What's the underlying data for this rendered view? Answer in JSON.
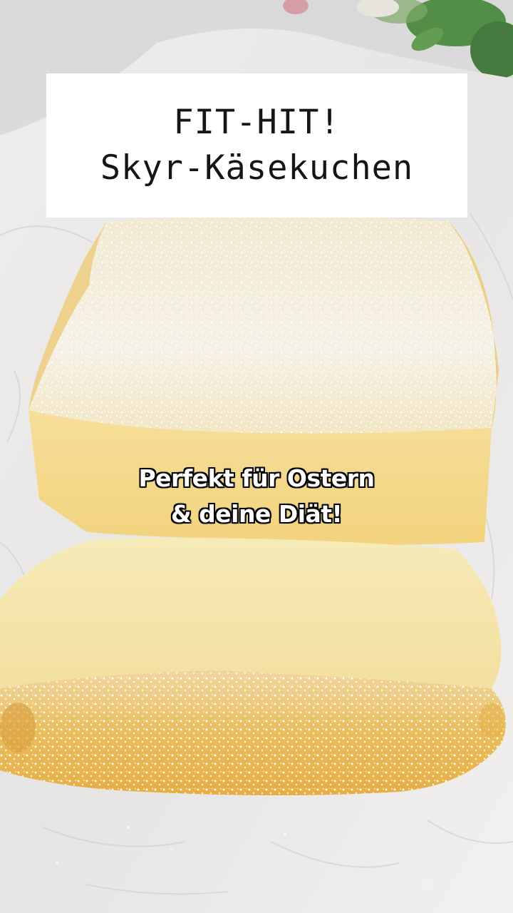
{
  "title_card": {
    "line1": "FIT-HIT!",
    "line2": "Skyr-Käsekuchen"
  },
  "caption": {
    "line1": "Perfekt für Ostern",
    "line2": "& deine Diät!"
  },
  "colors": {
    "parchment": "#ecebea",
    "cake_top_sugar": "#f3efe3",
    "cake_crumb": "#f4dd92",
    "cake_crust": "#e8b652",
    "herb_green": "#3f7a37"
  }
}
